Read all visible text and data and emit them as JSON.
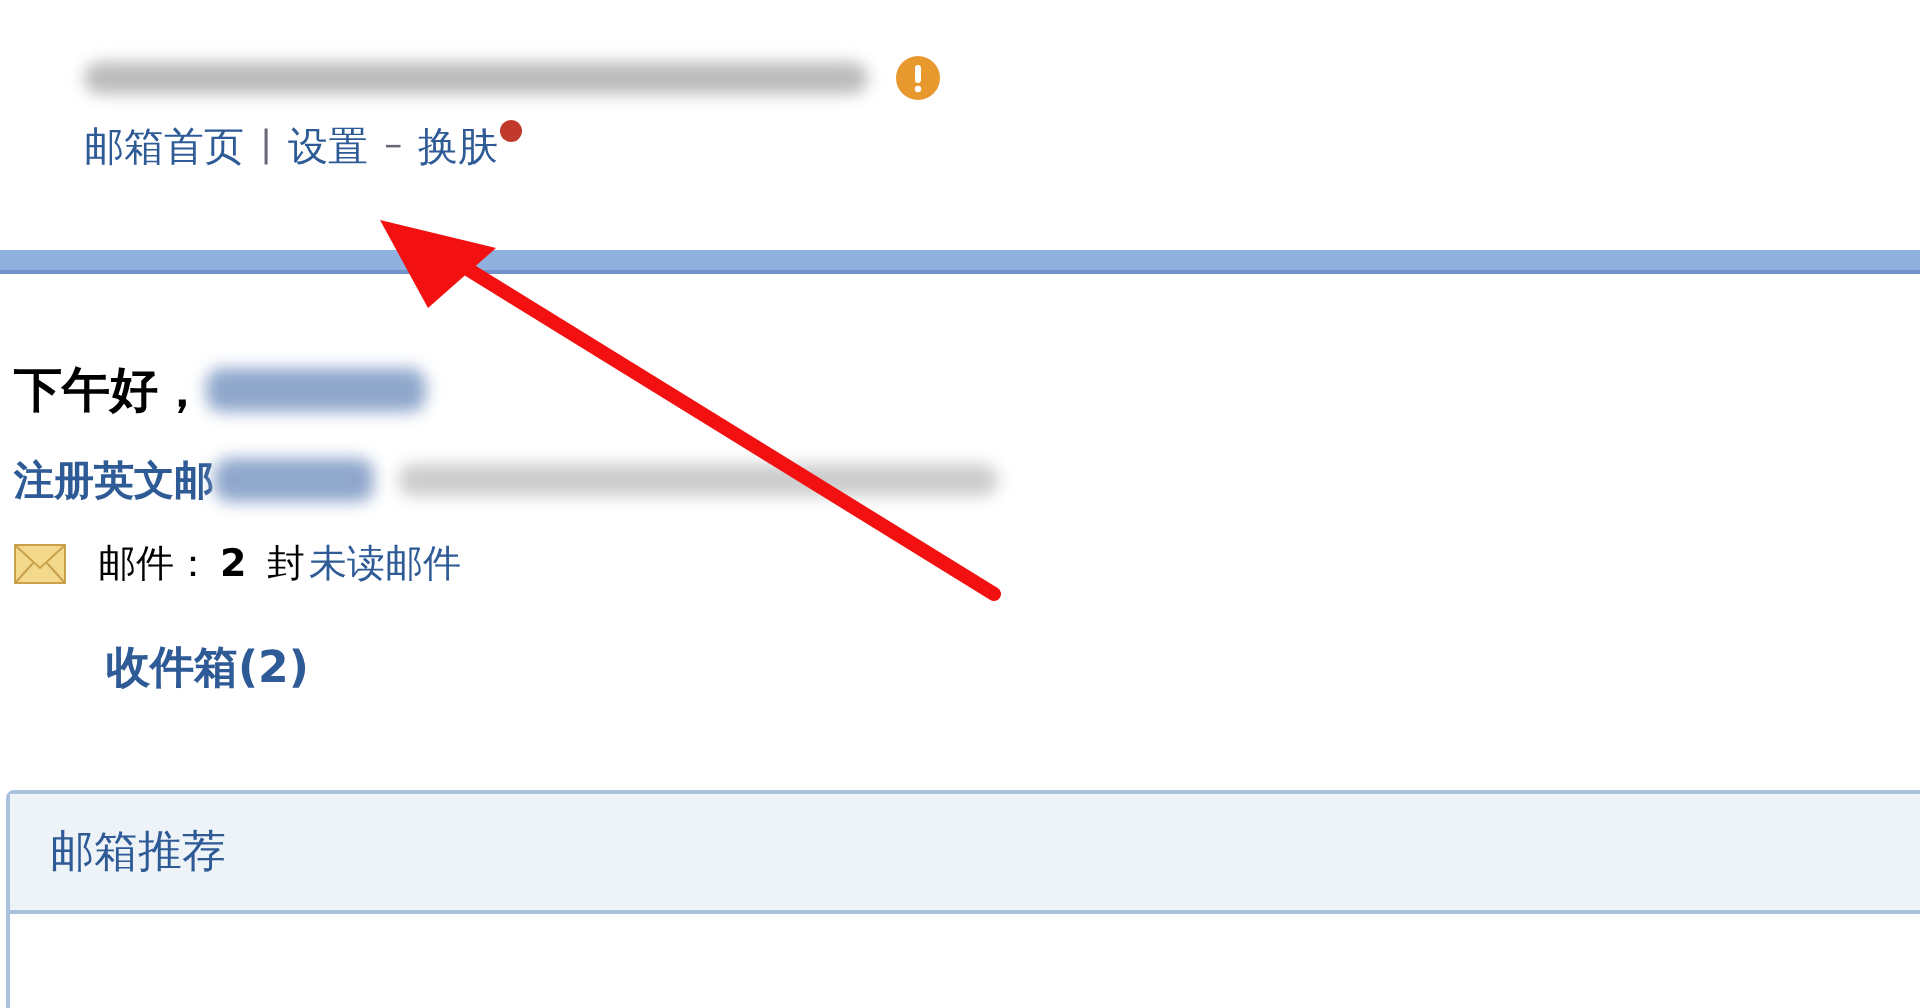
{
  "header": {
    "warning_icon": true,
    "links": [
      {
        "label": "邮箱首页"
      },
      {
        "label": "设置"
      },
      {
        "label": "换肤",
        "new_dot": true
      }
    ],
    "separators": [
      "|",
      "–"
    ]
  },
  "greeting": {
    "text": "下午好，"
  },
  "register_link": {
    "label": "注册英文邮"
  },
  "mail_summary": {
    "label": "邮件：",
    "count": "2",
    "unit": "封",
    "link": "未读邮件"
  },
  "inbox_link": {
    "label": "收件箱(2)"
  },
  "recommend_panel": {
    "title": "邮箱推荐"
  }
}
